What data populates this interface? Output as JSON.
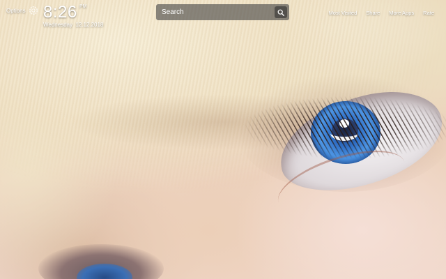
{
  "header": {
    "options_label": "Options",
    "time": "8:26",
    "ampm": "PM",
    "date": "Wednesday  12.12.2018"
  },
  "search": {
    "placeholder": "Search"
  },
  "nav": {
    "links": [
      "Most Visited",
      "Share",
      "More Apps",
      "Rate"
    ]
  },
  "icons": {
    "options": "gear-icon",
    "search": "search-icon"
  },
  "background": {
    "description_colors": {
      "hair": "#f1e4c6",
      "skin": "#eccfb8",
      "iris": "#3b82d8"
    }
  }
}
